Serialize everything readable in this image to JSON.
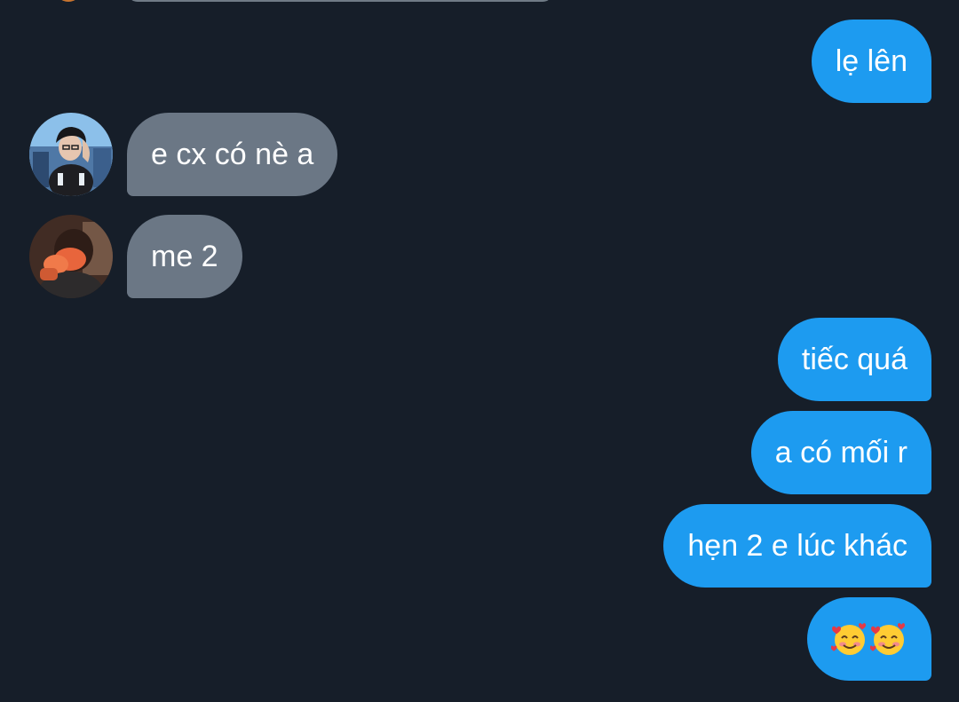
{
  "conversation": {
    "messages": [
      {
        "sender": "me",
        "text": "lẹ lên"
      },
      {
        "sender": "other",
        "text": "e cx có nè a"
      },
      {
        "sender": "other",
        "text": "me 2"
      },
      {
        "sender": "me",
        "text": "tiếc quá"
      },
      {
        "sender": "me",
        "text": "a có mối r"
      },
      {
        "sender": "me",
        "text": "hẹn 2 e lúc khác"
      },
      {
        "sender": "me",
        "emoji": [
          "smiling-face-with-hearts-icon",
          "smiling-face-with-hearts-icon"
        ]
      }
    ]
  },
  "colors": {
    "background": "#161e29",
    "sent_bubble": "#1d9bf0",
    "received_bubble": "#6b7785",
    "text": "#ffffff"
  }
}
